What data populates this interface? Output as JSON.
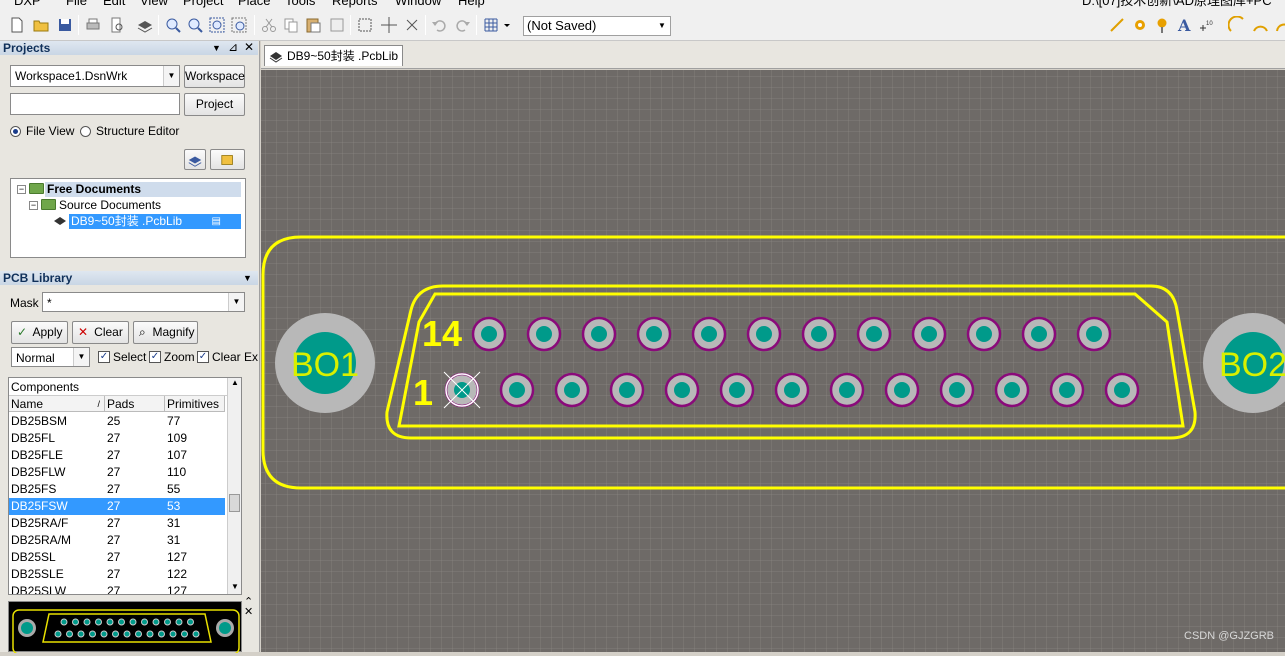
{
  "menu": {
    "items": [
      "DXP",
      "File",
      "Edit",
      "View",
      "Project",
      "Place",
      "Tools",
      "Reports",
      "Window",
      "Help"
    ],
    "path_text": "D:\\[07]技术创新\\AD原理图库+PC"
  },
  "toolbar": {
    "saved_state": "(Not Saved)"
  },
  "projects_panel": {
    "title": "Projects",
    "workspace_value": "Workspace1.DsnWrk",
    "workspace_button": "Workspace",
    "project_value": "",
    "project_button": "Project",
    "file_view_label": "File View",
    "structure_editor_label": "Structure Editor",
    "tree": {
      "root": "Free Documents",
      "group": "Source Documents",
      "file": "DB9~50封装 .PcbLib"
    }
  },
  "pcb_library": {
    "title": "PCB Library",
    "mask_label": "Mask",
    "mask_value": "*",
    "apply_label": "Apply",
    "clear_label": "Clear",
    "magnify_label": "Magnify",
    "mode_value": "Normal",
    "select_label": "Select",
    "zoom_label": "Zoom",
    "clear_existing_label": "Clear Exi",
    "components_title": "Components",
    "columns": [
      "Name",
      "Pads",
      "Primitives"
    ],
    "rows": [
      {
        "name": "DB25BSM",
        "pads": "25",
        "primitives": "77"
      },
      {
        "name": "DB25FL",
        "pads": "27",
        "primitives": "109"
      },
      {
        "name": "DB25FLE",
        "pads": "27",
        "primitives": "107"
      },
      {
        "name": "DB25FLW",
        "pads": "27",
        "primitives": "110"
      },
      {
        "name": "DB25FS",
        "pads": "27",
        "primitives": "55"
      },
      {
        "name": "DB25FSW",
        "pads": "27",
        "primitives": "53"
      },
      {
        "name": "DB25RA/F",
        "pads": "27",
        "primitives": "31"
      },
      {
        "name": "DB25RA/M",
        "pads": "27",
        "primitives": "31"
      },
      {
        "name": "DB25SL",
        "pads": "27",
        "primitives": "127"
      },
      {
        "name": "DB25SLE",
        "pads": "27",
        "primitives": "122"
      },
      {
        "name": "DB25SLW",
        "pads": "27",
        "primitives": "127"
      }
    ],
    "selected_row": 5
  },
  "document_tab": {
    "label": "DB9~50封装 .PcbLib"
  },
  "footprint": {
    "mount_left": "BO1",
    "mount_right": "BO2",
    "pin_label_top": "14",
    "pin_label_bottom": "1",
    "top_row_count": 12,
    "bottom_row_count": 13,
    "colors": {
      "board": "#6e6a67",
      "grid": "#8a8682",
      "outline": "#ffff00",
      "pad_ring": "#8a0a7a",
      "pad_copper": "#009a8a",
      "mount_ring": "#b8b8b8",
      "mount_label": "#d8f000"
    }
  },
  "watermark": "CSDN @GJZGRB"
}
